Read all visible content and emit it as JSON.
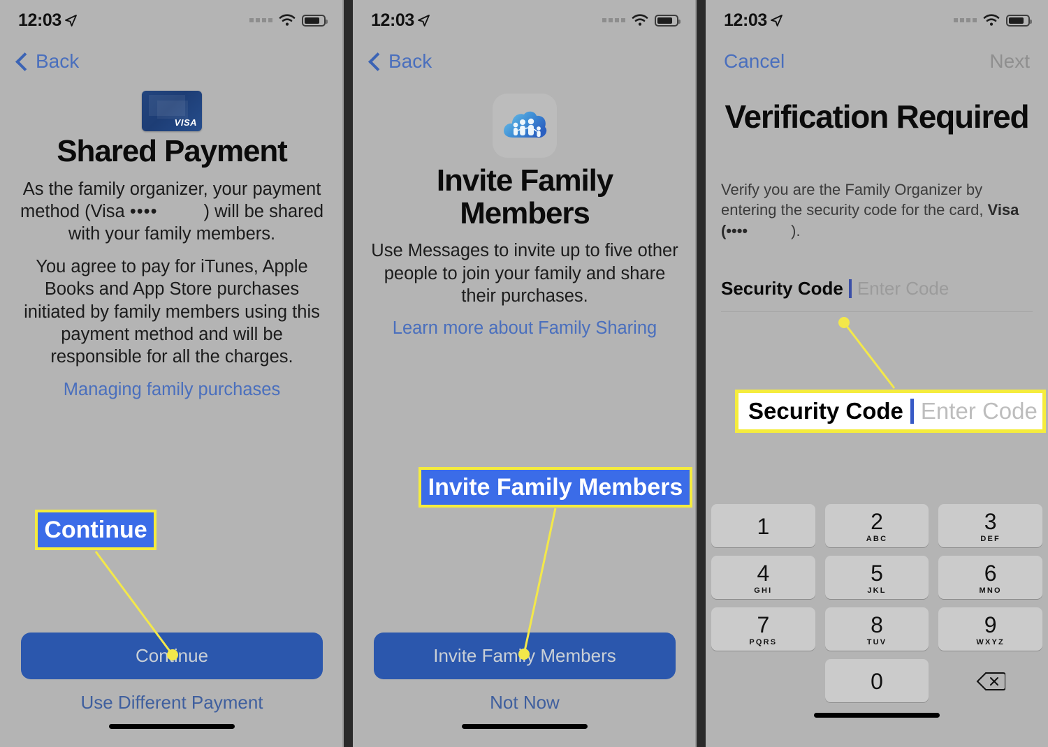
{
  "meta": {
    "accent_blue": "#4a6fbd",
    "button_blue": "#2b57ad",
    "callout_blue": "#3b6ce8",
    "callout_yellow": "#f5ec3d",
    "panel_bg": "#b4b4b4"
  },
  "status_bar": {
    "time": "12:03",
    "location_icon": "location-arrow-icon",
    "signal_icon": "signal-dots-icon",
    "wifi_icon": "wifi-icon",
    "battery_icon": "battery-icon"
  },
  "panel1": {
    "nav": {
      "back_label": "Back",
      "back_icon": "chevron-left-icon"
    },
    "card_icon": "visa-card-icon",
    "card_brand": "VISA",
    "title": "Shared Payment",
    "paragraph1_a": "As the family organizer, your payment method (Visa ",
    "paragraph1_dots": "••••",
    "paragraph1_b": ") will be shared with your family members.",
    "paragraph2": "You agree to pay for iTunes, Apple Books and App Store purchases initiated by family members using this payment method and will be responsible for all the charges.",
    "link": "Managing family purchases",
    "primary_button": "Continue",
    "secondary_link": "Use Different Payment",
    "callout": "Continue"
  },
  "panel2": {
    "nav": {
      "back_label": "Back",
      "back_icon": "chevron-left-icon"
    },
    "app_icon": "family-sharing-cloud-icon",
    "title": "Invite Family Members",
    "paragraph": "Use Messages to invite up to five other people to join your family and share their purchases.",
    "link": "Learn more about Family Sharing",
    "primary_button": "Invite Family Members",
    "secondary_link": "Not Now",
    "callout": "Invite Family Members"
  },
  "panel3": {
    "nav": {
      "cancel_label": "Cancel",
      "next_label": "Next"
    },
    "title": "Verification Required",
    "desc_a": "Verify you are the Family Organizer by entering the security code for the card, ",
    "desc_brand": "Visa (",
    "desc_dots": "••••",
    "desc_b": ").",
    "field_label": "Security Code",
    "field_placeholder": "Enter Code",
    "callout_label": "Security Code",
    "callout_placeholder": "Enter Code",
    "keypad": {
      "rows": [
        [
          {
            "num": "1",
            "letters": ""
          },
          {
            "num": "2",
            "letters": "ABC"
          },
          {
            "num": "3",
            "letters": "DEF"
          }
        ],
        [
          {
            "num": "4",
            "letters": "GHI"
          },
          {
            "num": "5",
            "letters": "JKL"
          },
          {
            "num": "6",
            "letters": "MNO"
          }
        ],
        [
          {
            "num": "7",
            "letters": "PQRS"
          },
          {
            "num": "8",
            "letters": "TUV"
          },
          {
            "num": "9",
            "letters": "WXYZ"
          }
        ],
        [
          {
            "num": "",
            "letters": ""
          },
          {
            "num": "0",
            "letters": ""
          },
          {
            "num": "",
            "letters": "delete-icon"
          }
        ]
      ]
    }
  }
}
